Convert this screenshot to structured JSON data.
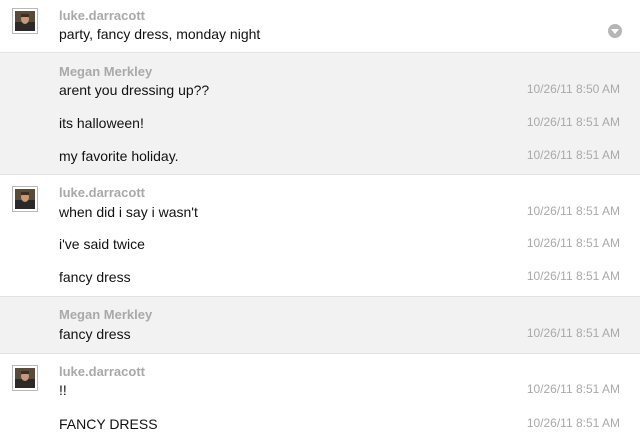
{
  "groups": [
    {
      "sender": "luke.darracott",
      "avatar": true,
      "menu": true,
      "messages": [
        {
          "text": "party, fancy dress, monday night",
          "time": ""
        }
      ]
    },
    {
      "sender": "Megan Merkley",
      "avatar": false,
      "messages": [
        {
          "text": "arent you dressing up??",
          "time": "10/26/11 8:50 AM"
        },
        {
          "text": "its halloween!",
          "time": "10/26/11 8:51 AM"
        },
        {
          "text": "my favorite holiday.",
          "time": "10/26/11 8:51 AM"
        }
      ]
    },
    {
      "sender": "luke.darracott",
      "avatar": true,
      "messages": [
        {
          "text": "when did i say i wasn't",
          "time": "10/26/11 8:51 AM"
        },
        {
          "text": "i've said twice",
          "time": "10/26/11 8:51 AM"
        },
        {
          "text": "fancy dress",
          "time": "10/26/11 8:51 AM"
        }
      ]
    },
    {
      "sender": "Megan Merkley",
      "avatar": false,
      "messages": [
        {
          "text": "fancy dress",
          "time": "10/26/11 8:51 AM"
        }
      ]
    },
    {
      "sender": "luke.darracott",
      "avatar": true,
      "messages": [
        {
          "text": "!!",
          "time": "10/26/11 8:51 AM"
        },
        {
          "text": "FANCY DRESS",
          "time": "10/26/11 8:51 AM"
        }
      ]
    }
  ],
  "colors": {
    "shade_background": "#f2f2f2",
    "sender_text": "#a9a9a9",
    "timestamp_text": "#a9a9a9",
    "message_text": "#111111"
  },
  "icons": {
    "avatar": "user-photo-icon",
    "menu": "chevron-down-icon"
  }
}
